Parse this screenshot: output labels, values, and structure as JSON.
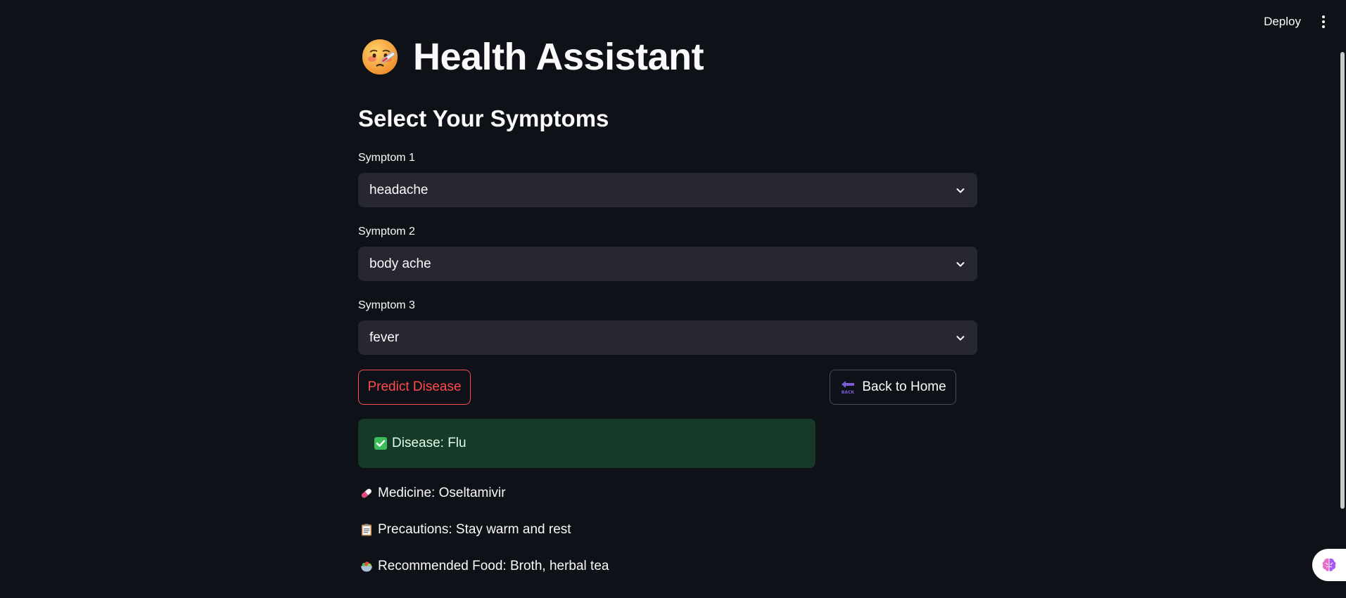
{
  "header": {
    "deploy_label": "Deploy",
    "menu_icon": "kebab-menu-icon"
  },
  "page": {
    "title": "Health Assistant",
    "title_icon": "sick-face-thermometer-emoji",
    "subheader": "Select Your Symptoms"
  },
  "symptoms": [
    {
      "label": "Symptom 1",
      "value": "headache"
    },
    {
      "label": "Symptom 2",
      "value": "body ache"
    },
    {
      "label": "Symptom 3",
      "value": "fever"
    }
  ],
  "buttons": {
    "predict_label": "Predict Disease",
    "back_label": "Back to Home",
    "back_icon": "back-arrow-emoji"
  },
  "result": {
    "disease": "Disease: Flu",
    "medicine": "Medicine: Oseltamivir",
    "precautions": "Precautions: Stay warm and rest",
    "food": "Recommended Food: Broth, herbal tea"
  },
  "icons": {
    "check": "check-mark-icon",
    "medicine": "pill-icon",
    "precautions": "clipboard-icon",
    "food": "salad-bowl-icon",
    "widget": "brain-icon"
  },
  "colors": {
    "background": "#0e1117",
    "select_bg": "#262730",
    "accent_red": "#ff4b4b",
    "success_bg": "#173928",
    "text": "#fafafa"
  }
}
